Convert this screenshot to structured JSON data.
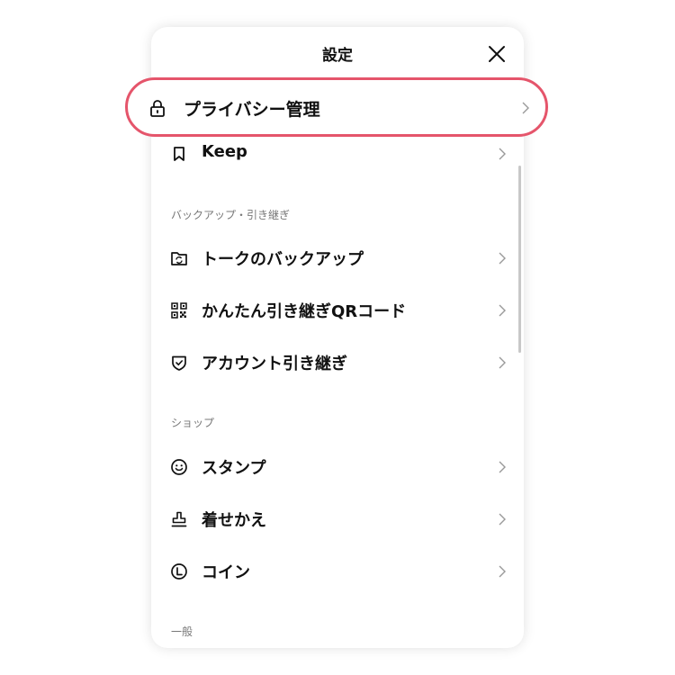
{
  "header": {
    "title": "設定"
  },
  "highlighted_item": {
    "label": "プライバシー管理",
    "icon": "lock-icon",
    "highlight_color": "#e5556b"
  },
  "items_top": [
    {
      "label": "Keep",
      "icon": "bookmark-icon"
    }
  ],
  "sections": [
    {
      "header": "バックアップ・引き継ぎ",
      "items": [
        {
          "label": "トークのバックアップ",
          "icon": "folder-sync-icon"
        },
        {
          "label": "かんたん引き継ぎQRコード",
          "icon": "qr-code-icon"
        },
        {
          "label": "アカウント引き継ぎ",
          "icon": "shield-check-icon"
        }
      ]
    },
    {
      "header": "ショップ",
      "items": [
        {
          "label": "スタンプ",
          "icon": "smiley-icon"
        },
        {
          "label": "着せかえ",
          "icon": "stamp-tool-icon"
        },
        {
          "label": "コイン",
          "icon": "coin-icon"
        }
      ]
    },
    {
      "header": "一般",
      "items": []
    }
  ]
}
